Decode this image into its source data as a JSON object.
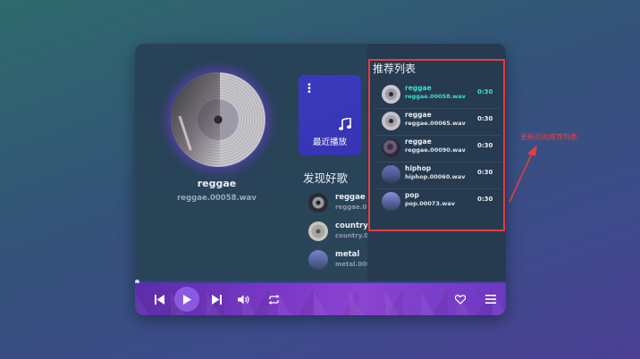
{
  "now_playing": {
    "title": "reggae",
    "file": "reggae.00058.wav"
  },
  "recent_card": {
    "menu_icon": "dots-vertical-icon",
    "icon": "music-note-icon",
    "label": "最近播放"
  },
  "discover": {
    "heading": "发现好歌",
    "items": [
      {
        "title": "reggae",
        "subtitle": "reggae.0"
      },
      {
        "title": "country",
        "subtitle": "country.0"
      },
      {
        "title": "metal",
        "subtitle": "metal.000"
      }
    ]
  },
  "recommend": {
    "heading": "推荐列表",
    "items": [
      {
        "title": "reggae",
        "file": "reggae.00058.wav",
        "duration": "0:30",
        "active": true
      },
      {
        "title": "reggae",
        "file": "reggae.00065.wav",
        "duration": "0:30",
        "active": false
      },
      {
        "title": "reggae",
        "file": "reggae.00090.wav",
        "duration": "0:30",
        "active": false
      },
      {
        "title": "hiphop",
        "file": "hiphop.00060.wav",
        "duration": "0:30",
        "active": false
      },
      {
        "title": "pop",
        "file": "pop.00073.wav",
        "duration": "0:30",
        "active": false
      }
    ]
  },
  "controls": {
    "icons": [
      "skip-previous-icon",
      "play-icon",
      "skip-next-icon",
      "volume-icon",
      "repeat-icon",
      "heart-icon",
      "menu-icon"
    ],
    "progress": 0.0
  },
  "annotation": {
    "text": "更新后的推荐列表"
  },
  "colors": {
    "accent": "#3ce0d4",
    "annotation": "#e43d3d",
    "card": "#3a3bbd",
    "controls": "#7b39c6"
  }
}
